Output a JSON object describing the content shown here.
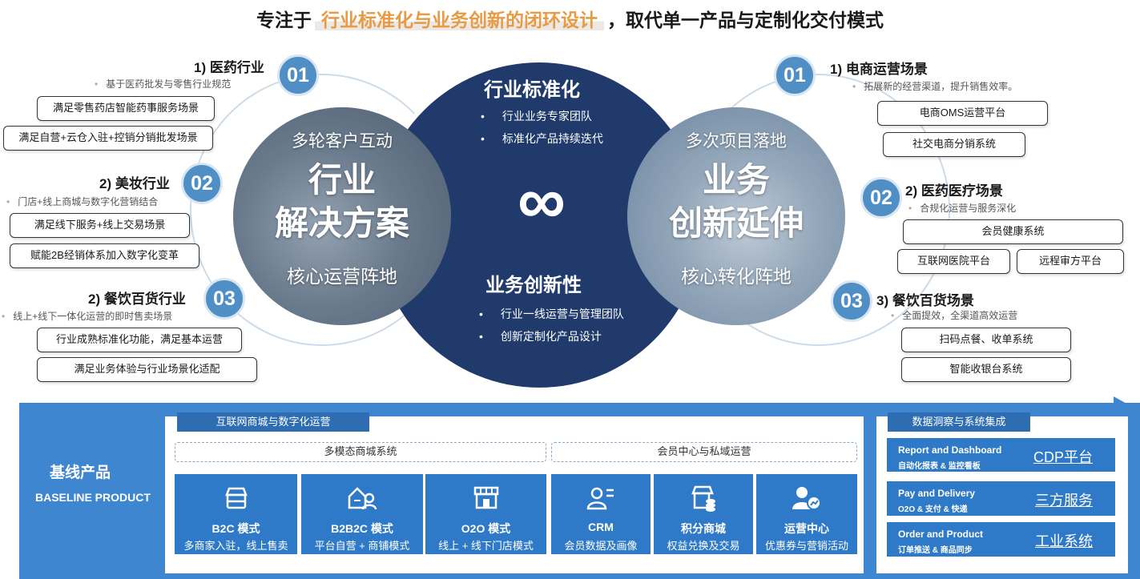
{
  "headline": {
    "pre": "专注于",
    "highlight": "行业标准化与业务创新的闭环设计",
    "post": "，取代单一产品与定制化交付模式"
  },
  "left_circle": {
    "top": "多轮客户互动",
    "big1": "行业",
    "big2": "解决方案",
    "bottom": "核心运营阵地"
  },
  "right_circle": {
    "top": "多次项目落地",
    "big1": "业务",
    "big2": "创新延伸",
    "bottom": "核心转化阵地"
  },
  "center": {
    "title1": "行业标准化",
    "items1": [
      "行业业务专家团队",
      "标准化产品持续迭代"
    ],
    "symbol": "∞",
    "title2": "业务创新性",
    "items2": [
      "行业一线运营与管理团队",
      "创新定制化产品设计"
    ]
  },
  "left_sections": [
    {
      "num": "01",
      "title": "1) 医药行业",
      "desc": "基于医药批发与零售行业规范",
      "tags": [
        "满足零售药店智能药事服务场景",
        "满足自营+云仓入驻+控销分销批发场景"
      ]
    },
    {
      "num": "02",
      "title": "2) 美妆行业",
      "desc": "门店+线上商城与数字化营销结合",
      "tags": [
        "满足线下服务+线上交易场景",
        "赋能2B经销体系加入数字化变革"
      ]
    },
    {
      "num": "03",
      "title": "2) 餐饮百货行业",
      "desc": "线上+线下一体化运营的即时售卖场景",
      "tags": [
        "行业成熟标准化功能，满足基本运营",
        "满足业务体验与行业场景化适配"
      ]
    }
  ],
  "right_sections": [
    {
      "num": "01",
      "title": "1) 电商运营场景",
      "desc": "拓展新的经营渠道，提升销售效率。",
      "tags": [
        "电商OMS运营平台",
        "社交电商分销系统"
      ]
    },
    {
      "num": "02",
      "title": "2) 医药医疗场景",
      "desc": "合规化运营与服务深化",
      "tags": [
        "会员健康系统",
        "互联网医院平台",
        "远程审方平台"
      ]
    },
    {
      "num": "03",
      "title": "3) 餐饮百货场景",
      "desc": "全面提效，全渠道高效运营",
      "tags": [
        "扫码点餐、收单系统",
        "智能收银台系统"
      ]
    }
  ],
  "baseline": {
    "cn": "基线产品",
    "en": "BASELINE PRODUCT"
  },
  "mall_panel": {
    "head": "互联网商城与数字化运营",
    "group1": "多模态商城系统",
    "group2": "会员中心与私域运营",
    "products": [
      {
        "icon": "store-icon",
        "name": "B2C 模式",
        "sub": "多商家入驻，线上售卖"
      },
      {
        "icon": "b2b2c-icon",
        "name": "B2B2C 模式",
        "sub": "平台自营 + 商铺模式"
      },
      {
        "icon": "shop-front-icon",
        "name": "O2O 模式",
        "sub": "线上 + 线下门店模式"
      },
      {
        "icon": "crm-icon",
        "name": "CRM",
        "sub": "会员数据及画像"
      },
      {
        "icon": "points-mall-icon",
        "name": "积分商城",
        "sub": "权益兑换及交易"
      },
      {
        "icon": "operation-center-icon",
        "name": "运营中心",
        "sub": "优惠券与营销活动"
      }
    ]
  },
  "data_panel": {
    "head": "数据洞察与系统集成",
    "rows": [
      {
        "t1": "Report and Dashboard",
        "t2": "自动化报表 & 监控看板",
        "link": "CDP平台"
      },
      {
        "t1": "Pay and Delivery",
        "t2": "O2O & 支付 & 快递",
        "link": "三方服务"
      },
      {
        "t1": "Order and Product",
        "t2": "订单推送 & 商品同步",
        "link": "工业系统"
      }
    ]
  },
  "colors": {
    "navy": "#1f3a6b",
    "accent_blue": "#3e86cf",
    "tile_blue": "#2f7ac8",
    "number_blue": "#4f8fc6",
    "highlight_orange": "#e89a45"
  }
}
